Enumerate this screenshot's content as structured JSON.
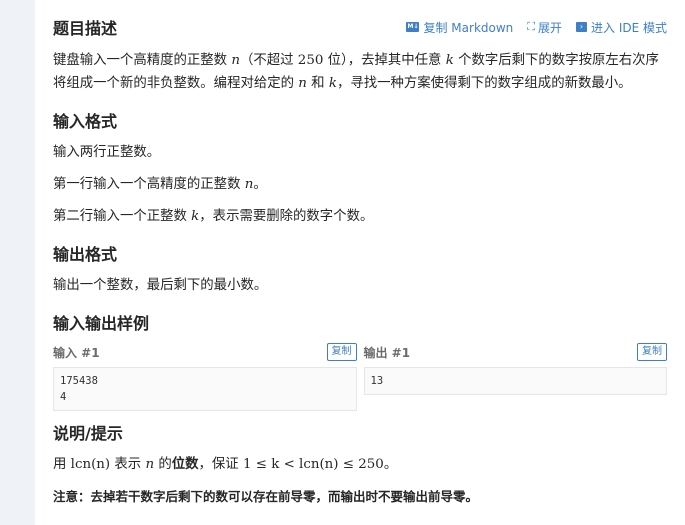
{
  "header": {
    "title": "题目描述",
    "copy_markdown": "复制 Markdown",
    "expand": "展开",
    "ide_mode": "进入 IDE 模式"
  },
  "description": {
    "l1a": "键盘输入一个高精度的正整数 ",
    "n": "n",
    "l1b": "（不超过 ",
    "limit": "250",
    "l1c": " 位），去掉其中任意 ",
    "k": "k",
    "l1d": " 个数字后剩下的数字按原左右次序",
    "l2a": "将组成一个新的非负整数。编程对给定的 ",
    "and": " 和 ",
    "l2b": "，寻找一种方案使得剩下的数字组成的新数最小。"
  },
  "input_format": {
    "title": "输入格式",
    "line1": "输入两行正整数。",
    "line2a": "第一行输入一个高精度的正整数 ",
    "line2b": "。",
    "line3a": "第二行输入一个正整数 ",
    "line3b": "，表示需要删除的数字个数。"
  },
  "output_format": {
    "title": "输出格式",
    "line1": "输出一个整数，最后剩下的最小数。"
  },
  "samples": {
    "title": "输入输出样例",
    "copy": "复制",
    "input_label": "输入 #1",
    "output_label": "输出 #1",
    "input_lines": [
      "175438",
      "4"
    ],
    "output_lines": [
      "13"
    ]
  },
  "hint": {
    "title": "说明/提示",
    "p1": "用 ",
    "lcn": "lcn",
    "n_paren": "(n)",
    "p2": " 表示 ",
    "p3": " 的",
    "bold": "位数",
    "p4": "，保证 ",
    "ineq": "1 ≤ k < lcn(n) ≤ 250",
    "p5": "。",
    "note": "注意：去掉若干数字后剩下的数可以存在前导零，而输出时不要输出前导零。"
  }
}
